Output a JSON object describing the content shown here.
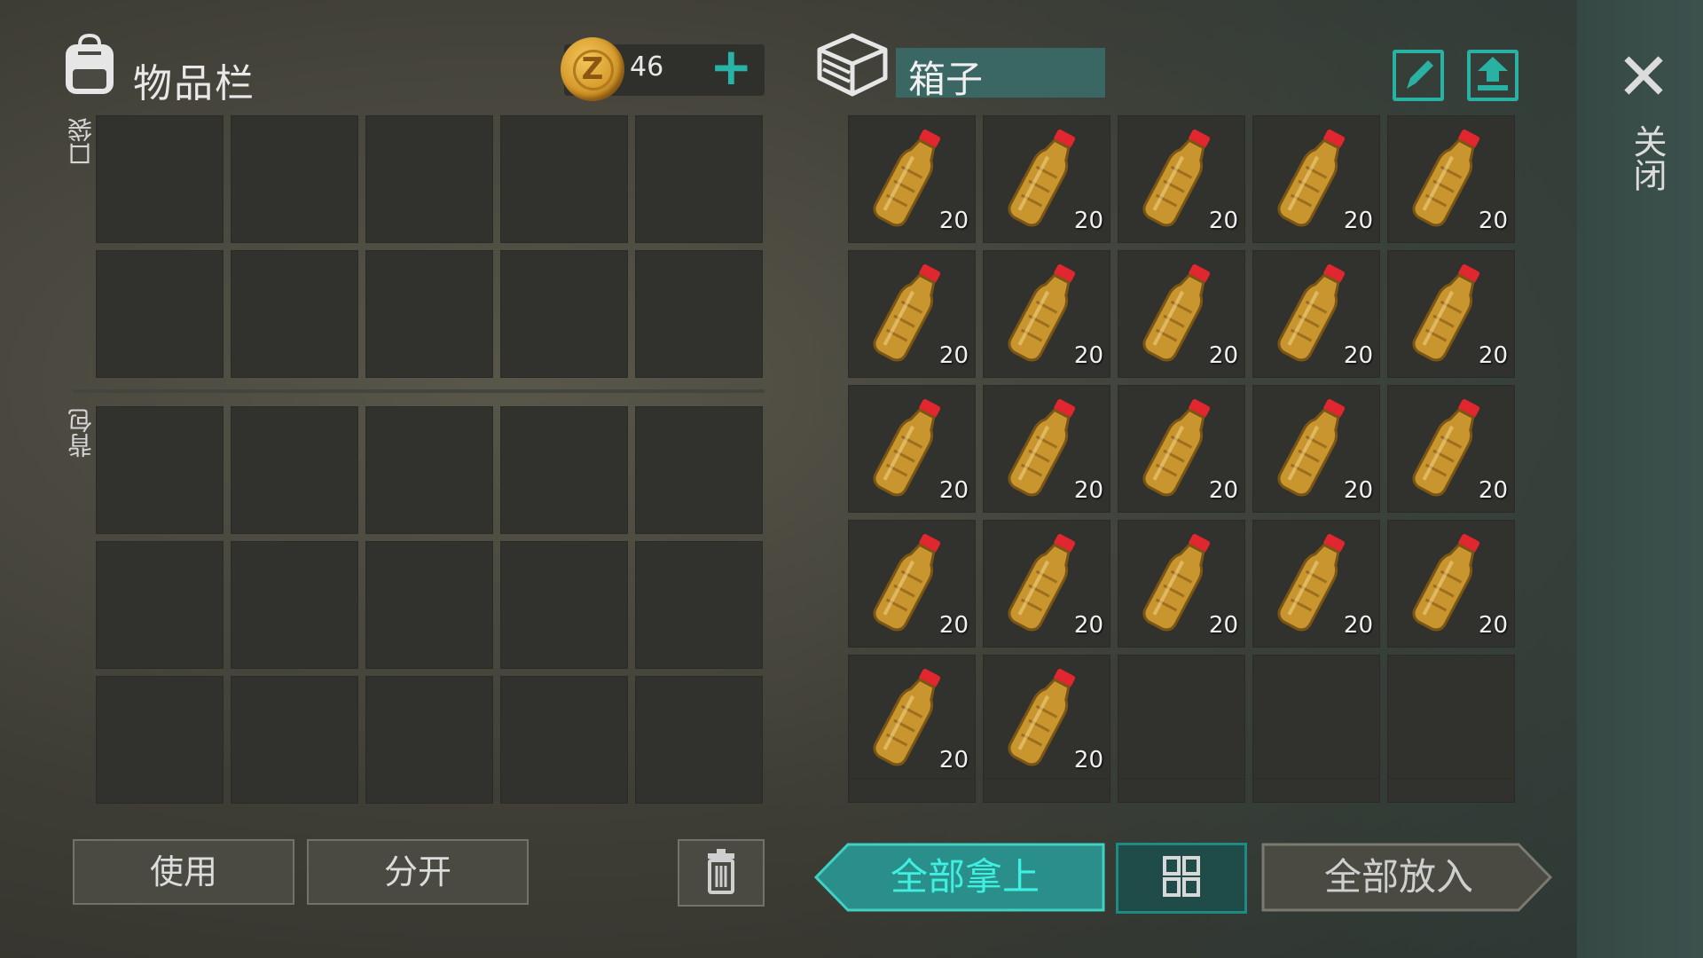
{
  "inventory": {
    "title": "物品栏",
    "coins": "46",
    "coin_letter": "Z",
    "pocket_label": "口袋",
    "backpack_label": "背包",
    "pocket_slots": 10,
    "backpack_slots": 15
  },
  "buttons": {
    "use": "使用",
    "split": "分开",
    "take_all": "全部拿上",
    "put_all": "全部放入"
  },
  "box": {
    "title": "箱子",
    "item_name": "water-bottle-icon",
    "items": [
      "20",
      "20",
      "20",
      "20",
      "20",
      "20",
      "20",
      "20",
      "20",
      "20",
      "20",
      "20",
      "20",
      "20",
      "20",
      "20",
      "20",
      "20",
      "20",
      "20",
      "20",
      "20"
    ],
    "empty_slots": 3
  },
  "close_label": "关闭",
  "colors": {
    "accent": "#29b1a4",
    "slot": "#31322e",
    "take_button": "#2a8f8a"
  }
}
